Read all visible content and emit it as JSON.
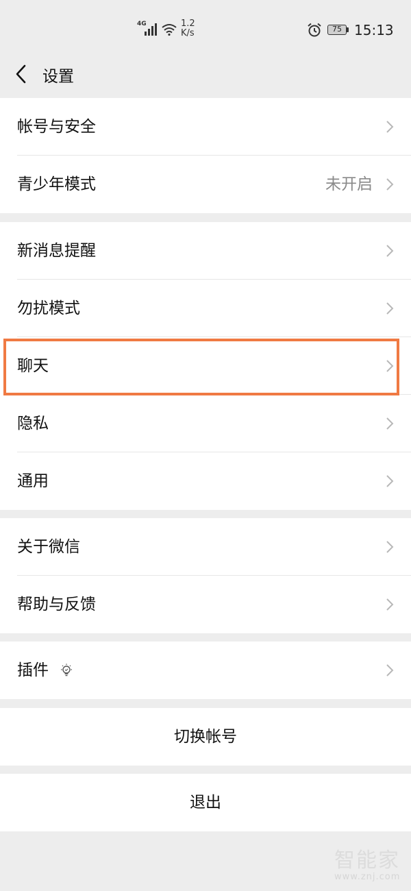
{
  "status_bar": {
    "network": "4G",
    "speed_value": "1.2",
    "speed_unit": "K/s",
    "battery": "75",
    "time": "15:13",
    "icons": [
      "signal-icon",
      "wifi-icon",
      "alarm-icon",
      "battery-icon"
    ]
  },
  "nav": {
    "title": "设置",
    "back_icon": "chevron-left-icon"
  },
  "groups": [
    {
      "items": [
        {
          "label": "帐号与安全"
        },
        {
          "label": "青少年模式",
          "value": "未开启"
        }
      ]
    },
    {
      "items": [
        {
          "label": "新消息提醒"
        },
        {
          "label": "勿扰模式"
        },
        {
          "label": "聊天",
          "highlighted": true
        },
        {
          "label": "隐私"
        },
        {
          "label": "通用"
        }
      ]
    },
    {
      "items": [
        {
          "label": "关于微信"
        },
        {
          "label": "帮助与反馈"
        }
      ]
    },
    {
      "items": [
        {
          "label": "插件",
          "icon": "lightbulb-icon"
        }
      ]
    }
  ],
  "actions": {
    "switch_account": "切换帐号",
    "logout": "退出"
  },
  "highlight_color": "#f07a43",
  "watermark": {
    "main": "智能家",
    "url": "www.znj.com"
  }
}
